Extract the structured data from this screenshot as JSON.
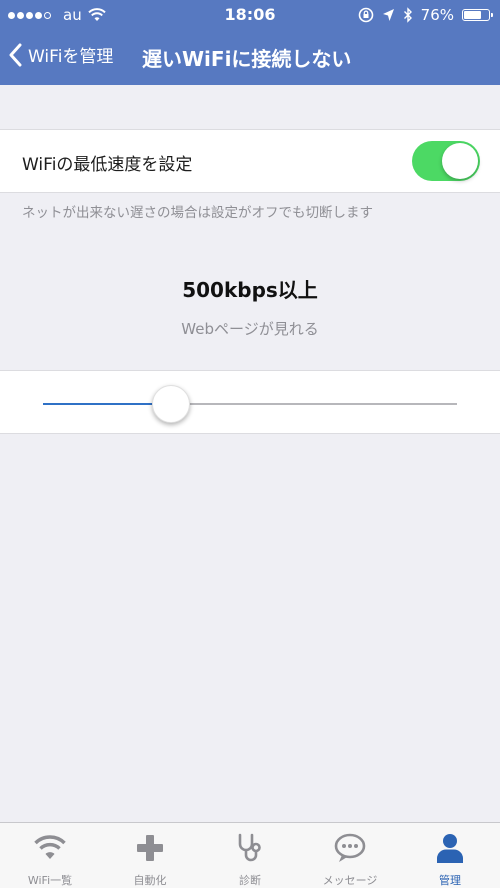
{
  "status_bar": {
    "carrier": "au",
    "time": "18:06",
    "battery": "76%",
    "battery_level": 0.76,
    "signal_bars": 4
  },
  "nav": {
    "back_label": "WiFiを管理",
    "title": "遅いWiFiに接続しない"
  },
  "settings": {
    "toggle_label": "WiFiの最低速度を設定",
    "toggle_on": true,
    "note": "ネットが出来ない遅さの場合は設定がオフでも切断します",
    "speed_value": "500kbps以上",
    "speed_desc": "Webページが見れる",
    "slider_level": 0.31
  },
  "tabs": [
    {
      "label": "WiFi一覧",
      "icon": "wifi-icon",
      "active": false
    },
    {
      "label": "自動化",
      "icon": "plus-icon",
      "active": false
    },
    {
      "label": "診断",
      "icon": "stethoscope-icon",
      "active": false
    },
    {
      "label": "メッセージ",
      "icon": "chat-bubble-icon",
      "active": false
    },
    {
      "label": "管理",
      "icon": "person-icon",
      "active": true
    }
  ],
  "colors": {
    "header": "#5779c1",
    "switch_on": "#4cd964",
    "slider_fill": "#2f71c6",
    "tab_active": "#2b63b3",
    "tab_inactive": "#8e8e93"
  }
}
